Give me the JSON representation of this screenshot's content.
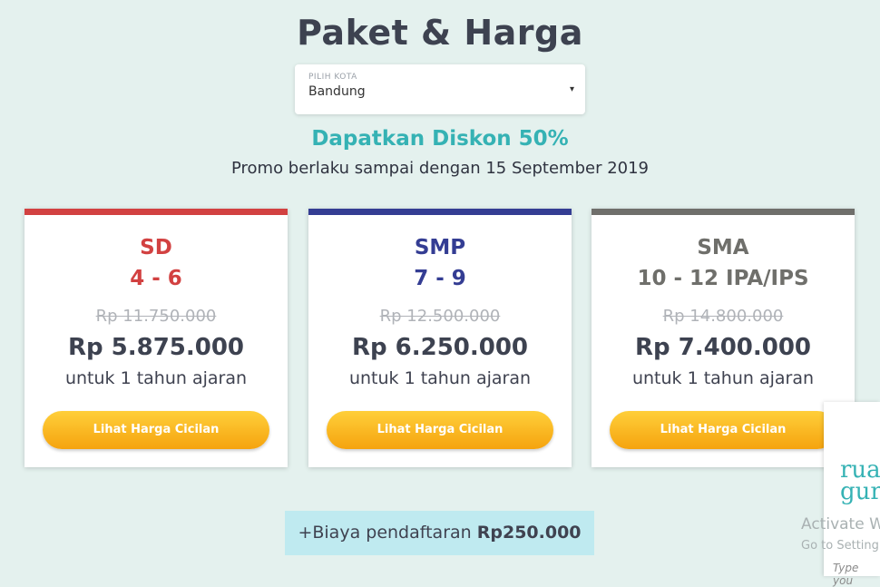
{
  "page": {
    "title": "Paket & Harga",
    "city_select": {
      "label": "PILIH KOTA",
      "value": "Bandung",
      "caret": "▾"
    },
    "promo_title": "Dapatkan Diskon 50%",
    "promo_subtitle": "Promo berlaku sampai dengan 15 September 2019"
  },
  "cards": [
    {
      "level": "SD",
      "grade": "4 - 6",
      "accent_color": "#d24141",
      "old_price": "Rp 11.750.000",
      "price": "Rp 5.875.000",
      "period": "untuk 1 tahun ajaran",
      "button_label": "Lihat Harga Cicilan"
    },
    {
      "level": "SMP",
      "grade": "7 - 9",
      "accent_color": "#343d93",
      "old_price": "Rp 12.500.000",
      "price": "Rp 6.250.000",
      "period": "untuk 1 tahun ajaran",
      "button_label": "Lihat Harga Cicilan"
    },
    {
      "level": "SMA",
      "grade": "10 - 12 IPA/IPS",
      "accent_color": "#6f6f6b",
      "old_price": "Rp 14.800.000",
      "price": "Rp 7.400.000",
      "period": "untuk 1 tahun ajaran",
      "button_label": "Lihat Harga Cicilan"
    }
  ],
  "registration_fee": {
    "prefix": "+Biaya pendaftaran ",
    "amount": "Rp250.000"
  },
  "side_widget": {
    "logo_line1": "rua",
    "logo_line2": "gur",
    "input_placeholder": "Type you"
  },
  "os_watermark": {
    "line1": "Activate W",
    "line2": "Go to Setting"
  }
}
